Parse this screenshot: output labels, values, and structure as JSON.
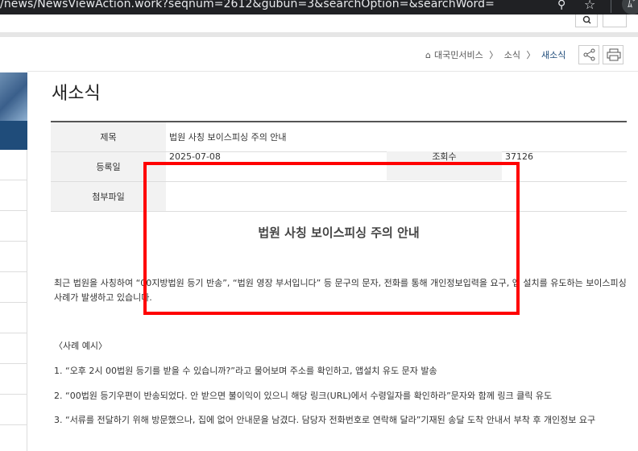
{
  "browser": {
    "url_text": "/news/NewsViewAction.work?seqnum=2612&gubun=3&searchOption=&searchWord=",
    "zoom_glyph": "⚲",
    "star_glyph": "☆",
    "ext_text": "ﾑﾞ"
  },
  "breadcrumb": {
    "home": "대국민서비스",
    "sep1": "〉",
    "level1": "소식",
    "sep2": "〉",
    "current": "새소식"
  },
  "page": {
    "title": "새소식"
  },
  "detail": {
    "title_label": "제목",
    "title_value": "법원 사칭 보이스피싱 주의 안내",
    "date_label": "등록일",
    "date_value": "2025-07-08",
    "views_label": "조회수",
    "views_value": "37126",
    "attach_label": "첨부파일",
    "attach_value": ""
  },
  "article": {
    "headline": "법원 사칭 보이스피싱 주의 안내",
    "paragraph": "최근 법원을 사칭하여 “00지방법원 등기 반송”, “법원 영장 부서입니다” 등 문구의 문자, 전화를 통해 개인정보입력을 요구, 앱 설치를 유도하는 보이스피싱 사례가 발생하고 있습니다.",
    "examples_heading": "〈사례 예시〉",
    "examples": [
      "1. “오후 2시 00법원 등기를 받을 수 있습니까?”라고 물어보며 주소를 확인하고, 앱설치 유도 문자 발송",
      "2. “00법원 등기우편이 반송되었다. 안 받으면 불이익이 있으니 해당 링크(URL)에서 수령일자를 확인하라”문자와 함께 링크 클릭 유도",
      "3. “서류를 전달하기 위해 방문했으나, 집에 없어 안내문을 남겼다. 담당자 전화번호로 연락해 달라”기재된 송달 도착 안내서 부착 후 개인정보 요구"
    ]
  },
  "colors": {
    "highlight": "#ff0000",
    "brand": "#1f4c7a"
  }
}
